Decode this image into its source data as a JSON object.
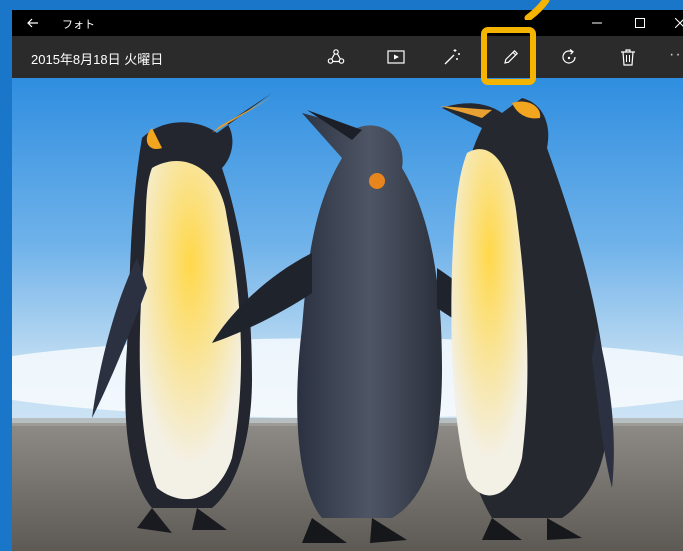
{
  "window": {
    "title": "フォト"
  },
  "toolbar": {
    "date": "2015年8月18日 火曜日"
  },
  "icons": {
    "back": "back-arrow-icon",
    "share": "share-icon",
    "slideshow": "slideshow-icon",
    "enhance": "magic-wand-icon",
    "edit": "pencil-icon",
    "rotate": "rotate-icon",
    "delete": "trash-icon",
    "more": "more-icon"
  },
  "colors": {
    "accent": "#f4b400",
    "desktop": "#1976c9",
    "titlebar": "#000000",
    "toolbar": "#2b2b2b"
  }
}
